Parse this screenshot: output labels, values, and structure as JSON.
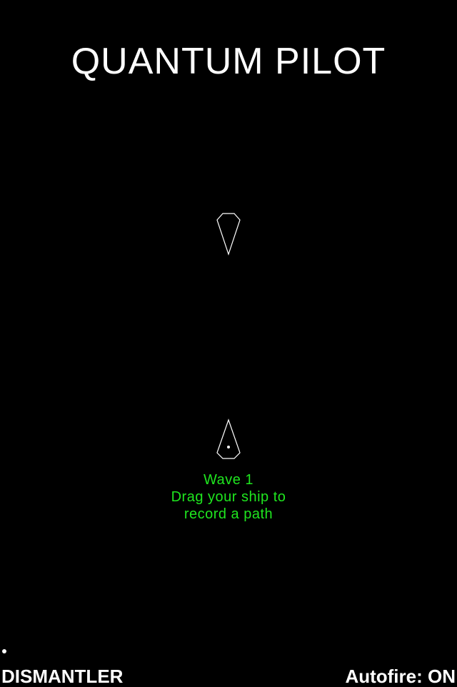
{
  "game": {
    "title": "QUANTUM PILOT"
  },
  "message": {
    "wave": "Wave 1",
    "line1": "Drag your ship to",
    "line2": "record a path",
    "color": "#1fe61f"
  },
  "hud": {
    "weapon": "DISMANTLER",
    "autofire": "Autofire: ON"
  },
  "icons": {
    "enemy": "enemy-ship-icon",
    "player": "player-ship-icon",
    "indicator": "life-dot-icon"
  }
}
